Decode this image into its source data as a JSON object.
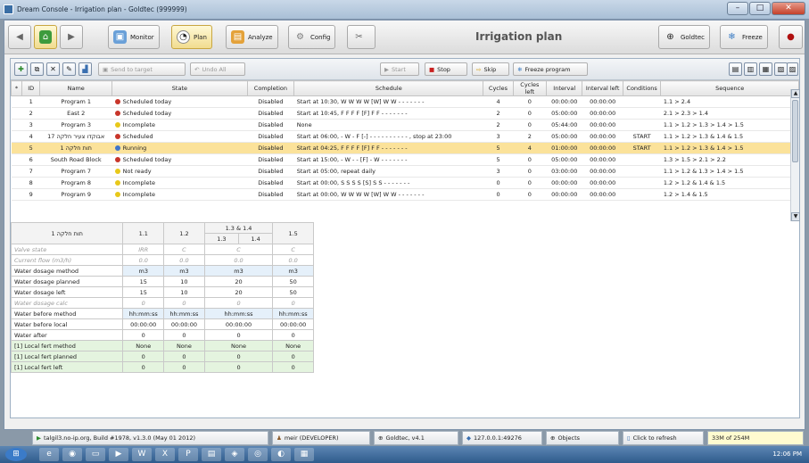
{
  "window": {
    "title": "Dream Console - Irrigation plan - Goldtec (999999)"
  },
  "toolbar": {
    "monitor": "Monitor",
    "plan": "Plan",
    "analyze": "Analyze",
    "config": "Config",
    "page_title": "Irrigation plan",
    "goldtec": "Goldtec",
    "freeze": "Freeze"
  },
  "actions": {
    "send_to_target": "Send to target",
    "undo_all": "Undo All",
    "start": "Start",
    "stop": "Stop",
    "skip": "Skip",
    "freeze_program": "Freeze program"
  },
  "colors": {
    "scheduled": "#c8352a",
    "incomplete": "#e8c81a",
    "running": "#3f74c9",
    "notready": "#e8c81a",
    "selected_row": "#fbe29a"
  },
  "programs_table": {
    "headers": [
      "*",
      "ID",
      "Name",
      "State",
      "Completion",
      "Schedule",
      "Cycles",
      "Cycles left",
      "Interval",
      "Interval left",
      "Conditions",
      "Sequence"
    ],
    "rows": [
      {
        "id": "1",
        "name": "Program 1",
        "state": "Scheduled today",
        "state_color": "#c8352a",
        "completion": "Disabled",
        "schedule": "Start at 10:30, W W W W [W] W W - - - - - - -",
        "cycles": "4",
        "cycles_left": "0",
        "interval": "00:00:00",
        "interval_left": "00:00:00",
        "conditions": "",
        "sequence": "1.1 > 2.4"
      },
      {
        "id": "2",
        "name": "East 2",
        "state": "Scheduled today",
        "state_color": "#c8352a",
        "completion": "Disabled",
        "schedule": "Start at 10:45, F F F F [F] F F - - - - - - -",
        "cycles": "2",
        "cycles_left": "0",
        "interval": "05:00:00",
        "interval_left": "00:00:00",
        "conditions": "",
        "sequence": "2.1 > 2.3 > 1.4"
      },
      {
        "id": "3",
        "name": "Program 3",
        "state": "Incomplete",
        "state_color": "#e8c81a",
        "completion": "Disabled",
        "schedule": "None",
        "cycles": "2",
        "cycles_left": "0",
        "interval": "05:44:00",
        "interval_left": "00:00:00",
        "conditions": "",
        "sequence": "1.1 > 1.2 > 1.3 > 1.4 > 1.5"
      },
      {
        "id": "4",
        "name": "אבוקדו צעיר חלקה 17",
        "state": "Scheduled",
        "state_color": "#c8352a",
        "completion": "Disabled",
        "schedule": "Start at 06:00, - W - F [-] - - - - - - - - - - , stop at 23:00",
        "cycles": "3",
        "cycles_left": "2",
        "interval": "05:00:00",
        "interval_left": "00:00:00",
        "conditions": "START",
        "sequence": "1.1 > 1.2 > 1.3 & 1.4 & 1.5"
      },
      {
        "id": "5",
        "name": "תות חלקה 1",
        "state": "Running",
        "state_color": "#3f74c9",
        "completion": "Disabled",
        "schedule": "Start at 04:25, F F F F [F] F F - - - - - - -",
        "cycles": "5",
        "cycles_left": "4",
        "interval": "01:00:00",
        "interval_left": "00:00:00",
        "conditions": "START",
        "sequence": "1.1 > 1.2 > 1.3 & 1.4 > 1.5",
        "selected": true
      },
      {
        "id": "6",
        "name": "South Road Block",
        "state": "Scheduled today",
        "state_color": "#c8352a",
        "completion": "Disabled",
        "schedule": "Start at 15:00, - W - - [F] - W - - - - - - -",
        "cycles": "5",
        "cycles_left": "0",
        "interval": "05:00:00",
        "interval_left": "00:00:00",
        "conditions": "",
        "sequence": "1.3 > 1.5 > 2.1 > 2.2"
      },
      {
        "id": "7",
        "name": "Program 7",
        "state": "Not ready",
        "state_color": "#e8c81a",
        "completion": "Disabled",
        "schedule": "Start at 05:00, repeat daily",
        "cycles": "3",
        "cycles_left": "0",
        "interval": "03:00:00",
        "interval_left": "00:00:00",
        "conditions": "",
        "sequence": "1.1 > 1.2 & 1.3 > 1.4 > 1.5"
      },
      {
        "id": "8",
        "name": "Program 8",
        "state": "Incomplete",
        "state_color": "#e8c81a",
        "completion": "Disabled",
        "schedule": "Start at 00:00, S S S S [S] S S - - - - - - -",
        "cycles": "0",
        "cycles_left": "0",
        "interval": "00:00:00",
        "interval_left": "00:00:00",
        "conditions": "",
        "sequence": "1.2 > 1.2 & 1.4 & 1.5"
      },
      {
        "id": "9",
        "name": "Program 9",
        "state": "Incomplete",
        "state_color": "#e8c81a",
        "completion": "Disabled",
        "schedule": "Start at 00:00, W W W W [W] W W - - - - - - -",
        "cycles": "0",
        "cycles_left": "0",
        "interval": "00:00:00",
        "interval_left": "00:00:00",
        "conditions": "",
        "sequence": "1.2 > 1.4 & 1.5"
      }
    ]
  },
  "detail": {
    "program_name": "תות חלקה 1",
    "group_header": "1.3 & 1.4",
    "columns": [
      "1.1",
      "1.2",
      "1.3",
      "1.4",
      "1.5"
    ],
    "rows": [
      {
        "label": "Valve state",
        "v": [
          "IRR",
          "C",
          "C",
          "C"
        ],
        "style": "gray"
      },
      {
        "label": "Current flow (m3/h)",
        "v": [
          "0.0",
          "0.0",
          "0.0",
          "0.0"
        ],
        "style": "gray"
      },
      {
        "label": "Water dosage method",
        "v": [
          "m3",
          "m3",
          "m3",
          "m3"
        ],
        "style": "blue"
      },
      {
        "label": "Water dosage planned",
        "v": [
          "15",
          "10",
          "20",
          "50"
        ],
        "style": "normal"
      },
      {
        "label": "Water dosage left",
        "v": [
          "15",
          "10",
          "20",
          "50"
        ],
        "style": "normal"
      },
      {
        "label": "Water dosage calc",
        "v": [
          "0",
          "0",
          "0",
          "0"
        ],
        "style": "gray"
      },
      {
        "label": "Water before method",
        "v": [
          "hh:mm:ss",
          "hh:mm:ss",
          "hh:mm:ss",
          "hh:mm:ss"
        ],
        "style": "blue"
      },
      {
        "label": "Water before local",
        "v": [
          "00:00:00",
          "00:00:00",
          "00:00:00",
          "00:00:00"
        ],
        "style": "normal"
      },
      {
        "label": "Water after",
        "v": [
          "0",
          "0",
          "0",
          "0"
        ],
        "style": "normal"
      },
      {
        "label": "[1]  Local fert method",
        "v": [
          "None",
          "None",
          "None",
          "None"
        ],
        "style": "fert"
      },
      {
        "label": "[1]  Local fert planned",
        "v": [
          "0",
          "0",
          "0",
          "0"
        ],
        "style": "fert"
      },
      {
        "label": "[1]  Local fert left",
        "v": [
          "0",
          "0",
          "0",
          "0"
        ],
        "style": "fert"
      }
    ]
  },
  "statusbar": {
    "build": "talgil3.no-ip.org, Build #1978, v1.3.0 (May 01 2012)",
    "user": "meir (DEVELOPER)",
    "target": "Goldtec, v4.1",
    "address": "127.0.0.1:49276",
    "objects": "Objects",
    "refresh": "Click to refresh",
    "memory": "33M of 254M"
  },
  "taskbar": {
    "clock": "12:06 PM"
  }
}
